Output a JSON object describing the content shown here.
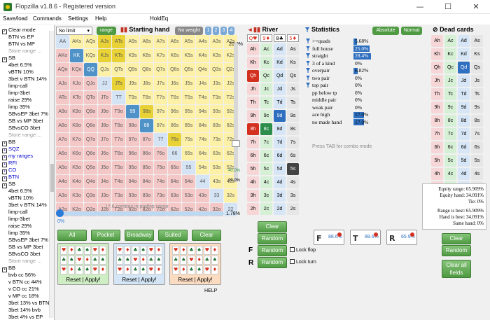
{
  "window": {
    "title": "Flopzilla v1.8.6 - Registered version",
    "minimize": "—",
    "maximize": "☐",
    "close": "✕"
  },
  "menu": [
    "Save/load",
    "Commands",
    "Settings",
    "Help",
    "HoldEq"
  ],
  "left_panel": {
    "clear_mode": "Clear mode",
    "items": [
      {
        "text": "BTN vs EP",
        "style": "indent"
      },
      {
        "text": "BTN vs MP",
        "style": "indent"
      },
      {
        "text": "Store range ...",
        "style": "indent muted"
      },
      {
        "text": "SB",
        "style": "group"
      },
      {
        "text": "4bet 6.5%",
        "style": "indent"
      },
      {
        "text": "vBTN 10%",
        "style": "indent"
      },
      {
        "text": "3bet v BTN 14%",
        "style": "indent"
      },
      {
        "text": "limp-call",
        "style": "indent"
      },
      {
        "text": "limp-3bet",
        "style": "indent"
      },
      {
        "text": "raise 29%",
        "style": "indent"
      },
      {
        "text": "limp 35%",
        "style": "indent"
      },
      {
        "text": "SBvsEP 3bet 7%",
        "style": "indent"
      },
      {
        "text": "SB vs MP 3bet",
        "style": "indent"
      },
      {
        "text": "SBvsCO 3bet",
        "style": "indent"
      },
      {
        "text": "Store range ...",
        "style": "indent muted"
      },
      {
        "text": "BB",
        "style": "group"
      },
      {
        "text": "SQZ",
        "style": "group"
      },
      {
        "text": "my ranges",
        "style": "group"
      },
      {
        "text": "RFI",
        "style": "group"
      },
      {
        "text": "CO",
        "style": "group"
      },
      {
        "text": "BTN",
        "style": "group"
      },
      {
        "text": "SB",
        "style": "group"
      },
      {
        "text": "4bet 6.5%",
        "style": "indent"
      },
      {
        "text": "vBTN 10%",
        "style": "indent"
      },
      {
        "text": "3bet v BTN 14%",
        "style": "indent"
      },
      {
        "text": "limp-call",
        "style": "indent"
      },
      {
        "text": "limp-3bet",
        "style": "indent"
      },
      {
        "text": "raise 29%",
        "style": "indent"
      },
      {
        "text": "limp 35%",
        "style": "indent"
      },
      {
        "text": "SBvsEP 3bet 7%",
        "style": "indent"
      },
      {
        "text": "SB vs MP 3bet",
        "style": "indent"
      },
      {
        "text": "SBvsCO 3bet",
        "style": "indent"
      },
      {
        "text": "Store range ...",
        "style": "indent muted"
      },
      {
        "text": "BB",
        "style": "group"
      },
      {
        "text": "bvb cc 56%",
        "style": "indent"
      },
      {
        "text": "v BTN cc 44%",
        "style": "indent"
      },
      {
        "text": "v CO cc 21%",
        "style": "indent"
      },
      {
        "text": "v MP cc 18%",
        "style": "indent"
      },
      {
        "text": "3bet 13% vs BTN",
        "style": "indent"
      },
      {
        "text": "3bet 14% bvb",
        "style": "indent"
      },
      {
        "text": "3bet 4% vs EP",
        "style": "indent"
      }
    ]
  },
  "range_controls": {
    "limit": "No limit",
    "range_btn": "range",
    "starting_hand": "Starting hand",
    "no_weight": "No weight",
    "weights": [
      "1",
      "2",
      "3",
      "4"
    ]
  },
  "hand_grid": {
    "ranks": [
      "A",
      "K",
      "Q",
      "J",
      "T",
      "9",
      "8",
      "7",
      "6",
      "5",
      "4",
      "3",
      "2"
    ],
    "selected": [
      "KK",
      "QQ",
      "99",
      "88",
      "AJs",
      "ATs",
      "KJs",
      "KTs",
      "JTs",
      "98s",
      "76s"
    ],
    "yellow_selected": [
      "AJs",
      "ATs",
      "KJs",
      "KTs",
      "JTs",
      "98s",
      "76s"
    ],
    "blue_selected": [
      "KK",
      "QQ",
      "99",
      "88"
    ]
  },
  "slider": {
    "top_pct": "20.0%",
    "bottom_pct": "20.0%",
    "mid_pct": "40.0%",
    "combos_label": "17.6 combos in preflop range",
    "range_pct": "1.78%",
    "h_left": "0%"
  },
  "range_buttons": [
    "All",
    "Pocket",
    "Broadway",
    "Suited",
    "Clear"
  ],
  "presets": [
    {
      "reset": "Reset",
      "apply": "Apply!"
    },
    {
      "reset": "Reset",
      "apply": "Apply!"
    },
    {
      "reset": "Reset",
      "apply": "Apply!"
    }
  ],
  "help": "HELP",
  "river": {
    "title": "River",
    "header": [
      "Q♥",
      "9♦",
      "8♣",
      "5♦"
    ],
    "rows": [
      [
        "Ah",
        "Ac",
        "Ad",
        "As"
      ],
      [
        "Kh",
        "Kc",
        "Kd",
        "Ks"
      ],
      [
        "Qh",
        "Qc",
        "Qd",
        "Qs"
      ],
      [
        "Jh",
        "Jc",
        "Jd",
        "Js"
      ],
      [
        "Th",
        "Tc",
        "Td",
        "Ts"
      ],
      [
        "9h",
        "9c",
        "9d",
        "9s"
      ],
      [
        "8h",
        "8c",
        "8d",
        "8s"
      ],
      [
        "7h",
        "7c",
        "7d",
        "7s"
      ],
      [
        "6h",
        "6c",
        "6d",
        "6s"
      ],
      [
        "5h",
        "5c",
        "5d",
        "5s"
      ],
      [
        "4h",
        "4c",
        "4d",
        "4s"
      ],
      [
        "3h",
        "3c",
        "3d",
        "3s"
      ],
      [
        "2h",
        "2c",
        "2d",
        "2s"
      ]
    ],
    "clear": "Clear",
    "random": "Random"
  },
  "statistics": {
    "title": "Statistics",
    "absolute": "Absolute",
    "normal": "Normal",
    "rows": [
      {
        "label": ">=quads",
        "value": "5.68%",
        "bar": 0.06
      },
      {
        "label": "full house",
        "value": "25.0%",
        "bar": 0.25
      },
      {
        "label": "straight",
        "value": "28.4%",
        "bar": 0.28
      },
      {
        "label": "3 of a kind",
        "value": "0%",
        "bar": 0
      },
      {
        "label": "overpair",
        "value": "6.82%",
        "bar": 0.07
      },
      {
        "label": "two pair",
        "value": "0%",
        "bar": 0
      },
      {
        "label": "top pair",
        "value": "0%",
        "bar": 0
      },
      {
        "label": "pp below tp",
        "value": "0%",
        "bar": 0
      },
      {
        "label": "middle pair",
        "value": "0%",
        "bar": 0
      },
      {
        "label": "weak pair",
        "value": "0%",
        "bar": 0
      },
      {
        "label": "ace high",
        "value": "17.0%",
        "bar": 0.17
      },
      {
        "label": "no made hand",
        "value": "17.0%",
        "bar": 0.17
      }
    ],
    "tab_hint": "Press TAB for combo mode"
  },
  "dead_cards": {
    "title": "Dead cards",
    "rows": [
      [
        "Ah",
        "Ac",
        "Ad",
        "As"
      ],
      [
        "Kh",
        "Kc",
        "Kd",
        "Ks"
      ],
      [
        "Qh",
        "Qc",
        "Qd",
        "Qs"
      ],
      [
        "Jh",
        "Jc",
        "Jd",
        "Js"
      ],
      [
        "Th",
        "Tc",
        "Td",
        "Ts"
      ],
      [
        "9h",
        "9c",
        "9d",
        "9s"
      ],
      [
        "8h",
        "8c",
        "8d",
        "8s"
      ],
      [
        "7h",
        "7c",
        "7d",
        "7s"
      ],
      [
        "6h",
        "6c",
        "6d",
        "6s"
      ],
      [
        "5h",
        "5c",
        "5d",
        "5s"
      ],
      [
        "4h",
        "4c",
        "4d",
        "4s"
      ],
      [
        "3h",
        "3c",
        "3d",
        "3s"
      ],
      [
        "2h",
        "2c",
        "2d",
        "2s"
      ]
    ]
  },
  "equity": {
    "equity_range": "Equity range: 65.909%",
    "equity_hand": "Equity hand: 34.091%",
    "tie": "Tie: 0%",
    "range_best": "Range is best: 65.909%",
    "hand_best": "Hand is best: 34.091%",
    "same_hand": "Same hand: 0%"
  },
  "filters": [
    {
      "letter": "F",
      "value": "88.6%"
    },
    {
      "letter": "T",
      "value": "88.6%"
    },
    {
      "letter": "R",
      "value": "65.9%"
    }
  ],
  "bottom_controls": {
    "random_flop": "Random",
    "lock_flop": "Lock flop",
    "random_turn": "Random",
    "lock_turn": "Lock turn",
    "clear": "Clear",
    "random": "Random",
    "clear_all": "Clear all fields"
  },
  "colors": {
    "accent_green": "#4f9a42",
    "accent_blue": "#2f6fbf"
  }
}
